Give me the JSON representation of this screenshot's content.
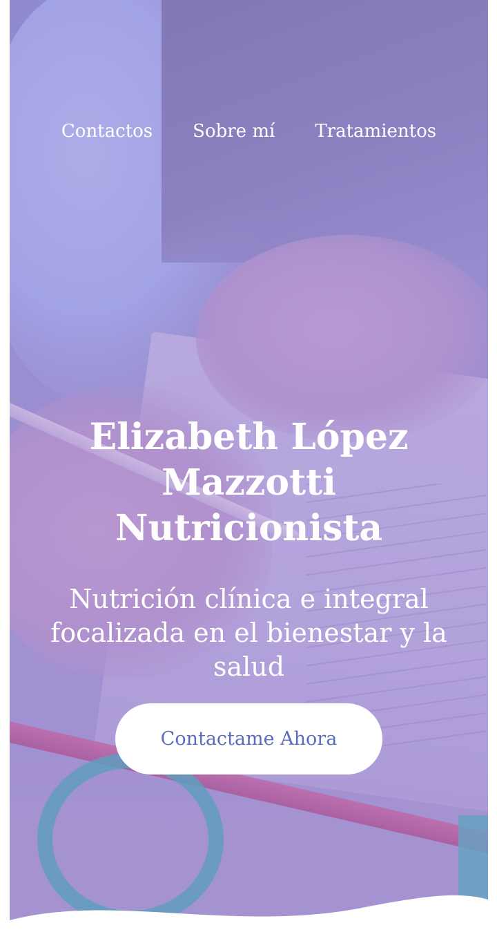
{
  "nav": {
    "items": [
      {
        "label": "Contactos"
      },
      {
        "label": "Sobre mí"
      },
      {
        "label": "Tratamientos"
      }
    ]
  },
  "hero": {
    "title_lines": [
      "Elizabeth López",
      "Mazzotti",
      "Nutricionista"
    ],
    "subtitle_lines": [
      "Nutrición clínica e integral",
      "focalizada en el bienestar y la",
      "salud"
    ],
    "cta_label": "Contactame Ahora"
  },
  "colors": {
    "overlay": "#8e80ce",
    "cta_background": "#ffffff",
    "cta_text": "#5b6bc0",
    "text": "#ffffff"
  }
}
